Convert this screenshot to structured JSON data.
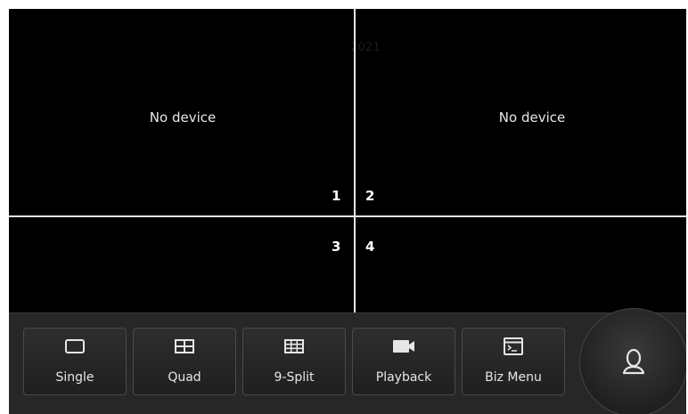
{
  "faint_text": "2021",
  "panes": [
    {
      "label": "No device",
      "number": "1"
    },
    {
      "label": "No device",
      "number": "2"
    },
    {
      "label": "",
      "number": "3"
    },
    {
      "label": "",
      "number": "4"
    }
  ],
  "toolbar": {
    "buttons": [
      {
        "label": "Single",
        "icon": "single-view-icon"
      },
      {
        "label": "Quad",
        "icon": "quad-view-icon"
      },
      {
        "label": "9-Split",
        "icon": "nine-split-icon"
      },
      {
        "label": "Playback",
        "icon": "camera-icon"
      },
      {
        "label": "Biz Menu",
        "icon": "terminal-window-icon"
      }
    ],
    "fab_icon": "user-icon"
  }
}
